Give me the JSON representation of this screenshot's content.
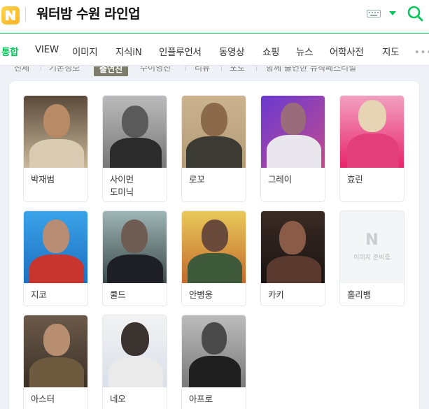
{
  "header": {
    "logo": "N",
    "query": "워터밤 수원 라인업"
  },
  "tabs": [
    "통합",
    "VIEW",
    "이미지",
    "지식iN",
    "인플루언서",
    "동영상",
    "쇼핑",
    "뉴스",
    "어학사전",
    "지도"
  ],
  "tabs_more": "•••",
  "subfilters": [
    "전체",
    "기본정보",
    "출연진",
    "수이영진",
    "리뷰",
    "포토",
    "함께 출연한 뮤직페스티벌"
  ],
  "lineup": [
    {
      "name": "박재범"
    },
    {
      "name": "사이먼 도미닉"
    },
    {
      "name": "로꼬"
    },
    {
      "name": "그레이"
    },
    {
      "name": "효린"
    },
    {
      "name": "지코"
    },
    {
      "name": "쿨드"
    },
    {
      "name": "안병웅"
    },
    {
      "name": "카키"
    },
    {
      "name": "홀리뱅",
      "placeholder": "이미지 준비중"
    },
    {
      "name": "아스터"
    },
    {
      "name": "네오"
    },
    {
      "name": "아프로"
    }
  ],
  "colors": {
    "accent": "#03c75a"
  }
}
